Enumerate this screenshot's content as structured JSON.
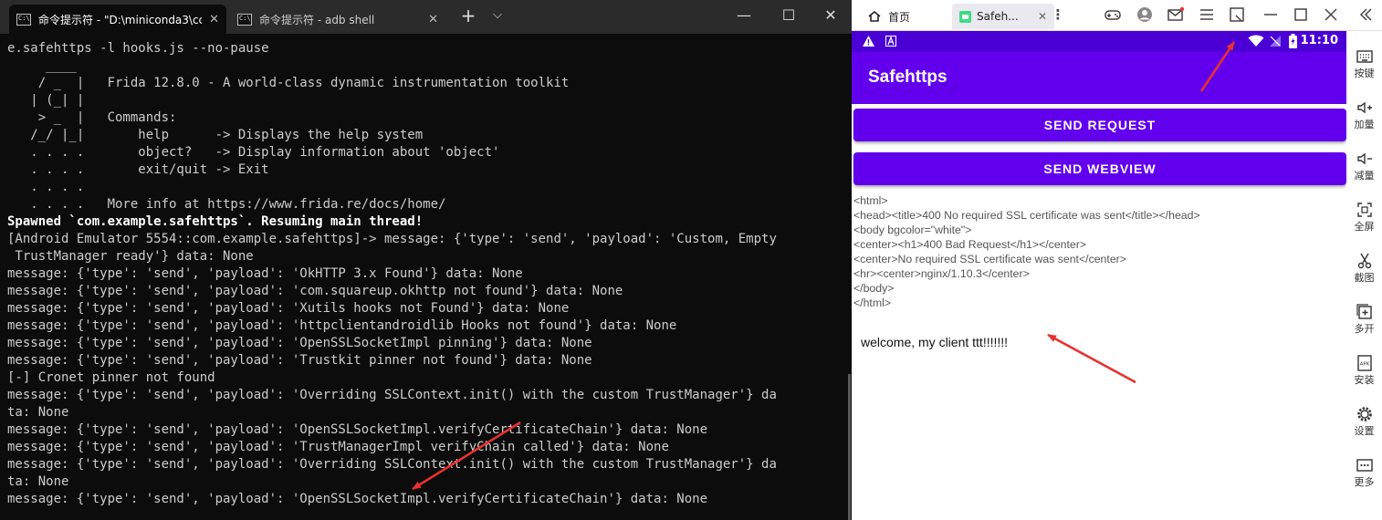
{
  "terminal": {
    "tabs": [
      {
        "title": "命令提示符 - \"D:\\miniconda3\\cc",
        "close": "✕"
      },
      {
        "title": "命令提示符 - adb  shell",
        "close": "✕"
      }
    ],
    "new_tab": "+",
    "dropdown": "⌵",
    "window_controls": {
      "minimize": "—",
      "maximize": "☐",
      "close": "✕"
    },
    "lines": [
      {
        "text": "e.safehttps -l hooks.js --no-pause",
        "bold": false
      },
      {
        "text": "     ____",
        "bold": false
      },
      {
        "text": "    / _  |   Frida 12.8.0 - A world-class dynamic instrumentation toolkit",
        "bold": false
      },
      {
        "text": "   | (_| |",
        "bold": false
      },
      {
        "text": "    > _  |   Commands:",
        "bold": false
      },
      {
        "text": "   /_/ |_|       help      -> Displays the help system",
        "bold": false
      },
      {
        "text": "   . . . .       object?   -> Display information about 'object'",
        "bold": false
      },
      {
        "text": "   . . . .       exit/quit -> Exit",
        "bold": false
      },
      {
        "text": "   . . . .",
        "bold": false
      },
      {
        "text": "   . . . .   More info at https://www.frida.re/docs/home/",
        "bold": false
      },
      {
        "text": "Spawned `com.example.safehttps`. Resuming main thread!",
        "bold": true
      },
      {
        "text": "[Android Emulator 5554::com.example.safehttps]-> message: {'type': 'send', 'payload': 'Custom, Empty",
        "bold": false
      },
      {
        "text": " TrustManager ready'} data: None",
        "bold": false
      },
      {
        "text": "message: {'type': 'send', 'payload': 'OkHTTP 3.x Found'} data: None",
        "bold": false
      },
      {
        "text": "message: {'type': 'send', 'payload': 'com.squareup.okhttp not found'} data: None",
        "bold": false
      },
      {
        "text": "message: {'type': 'send', 'payload': 'Xutils hooks not Found'} data: None",
        "bold": false
      },
      {
        "text": "message: {'type': 'send', 'payload': 'httpclientandroidlib Hooks not found'} data: None",
        "bold": false
      },
      {
        "text": "message: {'type': 'send', 'payload': 'OpenSSLSocketImpl pinning'} data: None",
        "bold": false
      },
      {
        "text": "message: {'type': 'send', 'payload': 'Trustkit pinner not found'} data: None",
        "bold": false
      },
      {
        "text": "[-] Cronet pinner not found",
        "bold": false
      },
      {
        "text": "message: {'type': 'send', 'payload': 'Overriding SSLContext.init() with the custom TrustManager'} da",
        "bold": false
      },
      {
        "text": "ta: None",
        "bold": false
      },
      {
        "text": "message: {'type': 'send', 'payload': 'OpenSSLSocketImpl.verifyCertificateChain'} data: None",
        "bold": false
      },
      {
        "text": "message: {'type': 'send', 'payload': 'TrustManagerImpl verifyChain called'} data: None",
        "bold": false
      },
      {
        "text": "message: {'type': 'send', 'payload': 'Overriding SSLContext.init() with the custom TrustManager'} da",
        "bold": false
      },
      {
        "text": "ta: None",
        "bold": false
      },
      {
        "text": "message: {'type': 'send', 'payload': 'OpenSSLSocketImpl.verifyCertificateChain'} data: None",
        "bold": false
      }
    ]
  },
  "emulator": {
    "tabs": {
      "home": "首页",
      "app": "Safeh..."
    },
    "tab_close": "✕",
    "more": "⋮",
    "status_time": "11:10",
    "app_title": "Safehttps",
    "buttons": {
      "send_request": "SEND REQUEST",
      "send_webview": "SEND WEBVIEW"
    },
    "webview_lines": [
      "<html>",
      "<head><title>400 No required SSL certificate was sent</title></head>",
      "<body bgcolor=\"white\">",
      "<center><h1>400 Bad Request</h1></center>",
      "<center>No required SSL certificate was sent</center>",
      "<hr><center>nginx/1.10.3</center>",
      "</body>",
      "</html>"
    ],
    "welcome_text": "welcome, my client ttt!!!!!!!",
    "side_toolbar": [
      {
        "label": "按键",
        "icon": "keyboard-icon"
      },
      {
        "label": "加量",
        "icon": "volume-up-icon"
      },
      {
        "label": "减量",
        "icon": "volume-down-icon"
      },
      {
        "label": "全屏",
        "icon": "fullscreen-icon"
      },
      {
        "label": "截图",
        "icon": "scissors-icon"
      },
      {
        "label": "多开",
        "icon": "multi-instance-icon"
      },
      {
        "label": "安装",
        "icon": "apk-icon"
      },
      {
        "label": "设置",
        "icon": "gear-icon"
      },
      {
        "label": "更多",
        "icon": "more-icon"
      }
    ]
  },
  "colors": {
    "terminal_bg": "#0c0c0c",
    "terminal_text": "#cccccc",
    "app_primary": "#6200ee",
    "status_bar": "#4a00d4",
    "annotation_arrow": "#e8312f"
  }
}
